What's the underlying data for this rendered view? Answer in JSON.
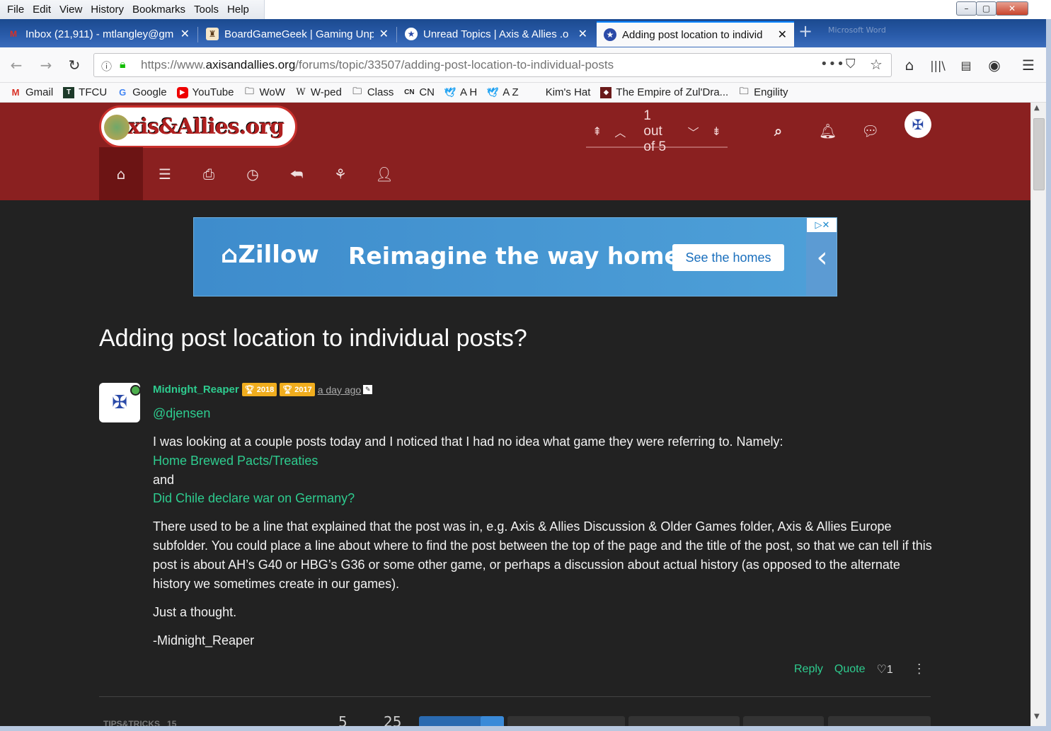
{
  "menu": [
    "File",
    "Edit",
    "View",
    "History",
    "Bookmarks",
    "Tools",
    "Help"
  ],
  "tabs": [
    {
      "label": "Inbox (21,911) - mtlangley@gm",
      "icon": "gmail-icon"
    },
    {
      "label": "BoardGameGeek | Gaming Unp",
      "icon": "bgg-icon"
    },
    {
      "label": "Unread Topics | Axis & Allies .o",
      "icon": "axis-allies-icon"
    },
    {
      "label": "Adding post location to individ",
      "icon": "axis-allies-icon"
    }
  ],
  "ghost_title": "Microsoft Word",
  "address": {
    "prefix": "https://www.",
    "domain": "axisandallies.org",
    "path": "/forums/topic/33507/adding-post-location-to-individual-posts"
  },
  "bookmarks": [
    "Gmail",
    "TFCU",
    "Google",
    "YouTube",
    "WoW",
    "W-ped",
    "Class",
    "CN",
    "A H",
    "A Z",
    "Kim's Hat",
    "The Empire of Zul'Dra...",
    "Engility"
  ],
  "site": {
    "logo_text": "Axis&Allies.org",
    "pager_text": "1 out of 5"
  },
  "ad": {
    "brand": "Zillow",
    "tagline": "Reimagine the way home.",
    "cta": "See the homes"
  },
  "post": {
    "title": "Adding post location to individual posts?",
    "username": "Midnight_Reaper",
    "badges": [
      "2018",
      "2017"
    ],
    "time": "a day ago",
    "mention": "@djensen",
    "line1": "I was looking at a couple posts today and I noticed that I had no idea what game they were referring to. Namely:",
    "link1": "Home Brewed Pacts/Treaties",
    "and": "and",
    "link2": "Did Chile declare war on Germany?",
    "para2": "There used to be a line that explained that the post was in, e.g. Axis & Allies Discussion & Older Games folder, Axis & Allies Europe subfolder. You could place a line about where to find the post between the top of the page and the title of the post, so that we can tell if this post is about AH’s G40 or HBG’s G36 or some other game, or perhaps a discussion about actual history (as opposed to the alternate history we sometimes create in our games).",
    "para3": "Just a thought.",
    "signature": "-Midnight_Reaper",
    "reply": "Reply",
    "quote": "Quote",
    "votes": "1"
  },
  "footer": {
    "label": "TIPS&TRICKS",
    "count": "15",
    "n1": "5",
    "n2": "25"
  }
}
